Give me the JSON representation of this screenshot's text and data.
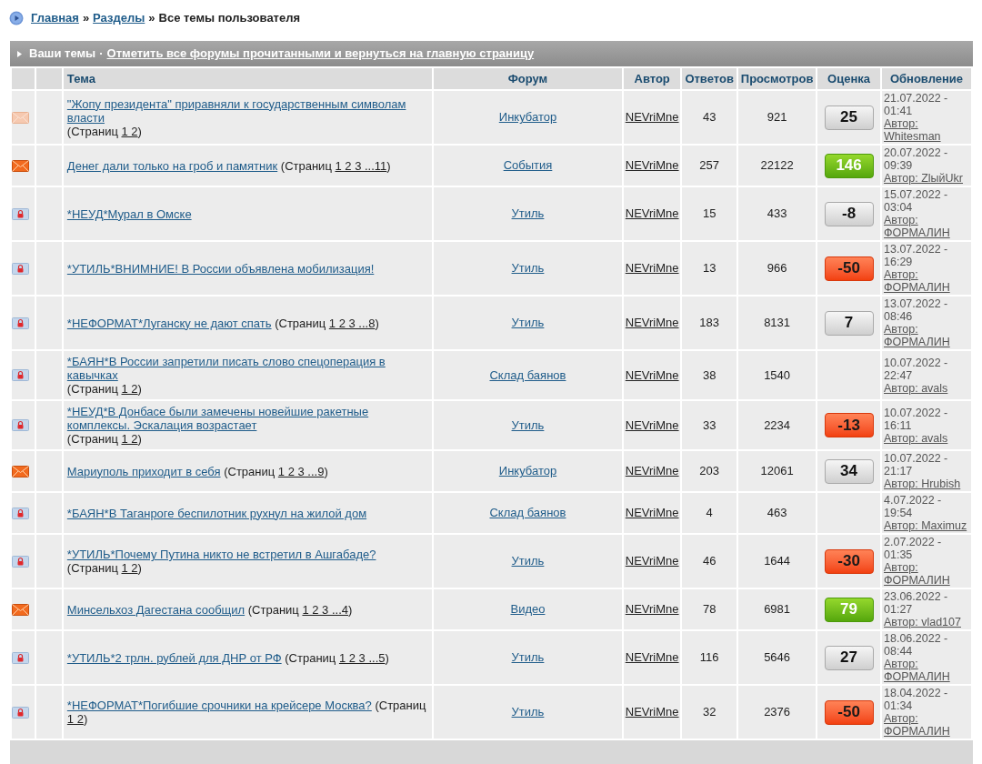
{
  "breadcrumb": {
    "links": [
      "Главная",
      "Разделы"
    ],
    "separators": [
      "»",
      "»"
    ],
    "current": "Все темы пользователя"
  },
  "section": {
    "title": "Ваши темы",
    "separator": "·",
    "link": "Отметить все форумы прочитанными и вернуться на главную страницу"
  },
  "columns": [
    "Тема",
    "Форум",
    "Автор",
    "Ответов",
    "Просмотров",
    "Оценка",
    "Обновление"
  ],
  "rows": [
    {
      "kind": "read",
      "title": "\"Жопу президента\" приравняли к государственным символам власти",
      "pages": {
        "open": "(Страниц",
        "links": "1 2",
        "close": ")"
      },
      "forum": "Инкубатор",
      "author": "NEVriMne",
      "replies": "43",
      "views": "921",
      "rating": {
        "value": "25",
        "kind": "neutral"
      },
      "updated": "21.07.2022 - 01:41",
      "updated_by": "Автор: Whitesman"
    },
    {
      "kind": "hot",
      "title": "Денег дали только на гроб и памятник",
      "pages": {
        "open": "(Страниц",
        "links": "1 2 3 ...11",
        "close": ")"
      },
      "forum": "События",
      "author": "NEVriMne",
      "replies": "257",
      "views": "22122",
      "rating": {
        "value": "146",
        "kind": "positive"
      },
      "updated": "20.07.2022 - 09:39",
      "updated_by": "Автор: ZlыйUkr"
    },
    {
      "kind": "locked",
      "title": "*НЕУД*Мурал в Омске",
      "forum": "Утиль",
      "author": "NEVriMne",
      "replies": "15",
      "views": "433",
      "rating": {
        "value": "-8",
        "kind": "neutral"
      },
      "updated": "15.07.2022 - 03:04",
      "updated_by": "Автор: ФОРМАЛИН"
    },
    {
      "kind": "locked",
      "title": "*УТИЛЬ*ВНИМНИЕ! В России объявлена мобилизация!",
      "forum": "Утиль",
      "author": "NEVriMne",
      "replies": "13",
      "views": "966",
      "rating": {
        "value": "-50",
        "kind": "negative"
      },
      "updated": "13.07.2022 - 16:29",
      "updated_by": "Автор: ФОРМАЛИН"
    },
    {
      "kind": "locked",
      "title": "*НЕФОРМАТ*Луганску не дают спать",
      "pages": {
        "open": "(Страниц",
        "links": "1 2 3 ...8",
        "close": ")"
      },
      "forum": "Утиль",
      "author": "NEVriMne",
      "replies": "183",
      "views": "8131",
      "rating": {
        "value": "7",
        "kind": "neutral"
      },
      "updated": "13.07.2022 - 08:46",
      "updated_by": "Автор: ФОРМАЛИН"
    },
    {
      "kind": "locked",
      "title": "*БАЯН*В России запретили писать слово спецоперация в кавычках",
      "pages": {
        "open": "(Страниц",
        "links": "1 2",
        "close": ")"
      },
      "forum": "Склад баянов",
      "author": "NEVriMne",
      "replies": "38",
      "views": "1540",
      "updated": "10.07.2022 - 22:47",
      "updated_by": "Автор: avals"
    },
    {
      "kind": "locked",
      "title": "*НЕУД*В Донбасе были замечены новейшие ракетные комплексы. Эскалация возрастает",
      "pages": {
        "open": "(Страниц",
        "links": "1 2",
        "close": ")"
      },
      "forum": "Утиль",
      "author": "NEVriMne",
      "replies": "33",
      "views": "2234",
      "rating": {
        "value": "-13",
        "kind": "negative"
      },
      "updated": "10.07.2022 - 16:11",
      "updated_by": "Автор: avals"
    },
    {
      "kind": "hot",
      "title": "Мариуполь приходит в себя",
      "pages": {
        "open": "(Страниц",
        "links": "1 2 3 ...9",
        "close": ")"
      },
      "forum": "Инкубатор",
      "author": "NEVriMne",
      "replies": "203",
      "views": "12061",
      "rating": {
        "value": "34",
        "kind": "neutral"
      },
      "updated": "10.07.2022 - 21:17",
      "updated_by": "Автор: Hrubish"
    },
    {
      "kind": "locked",
      "title": "*БАЯН*В Таганроге беспилотник рухнул на жилой дом",
      "forum": "Склад баянов",
      "author": "NEVriMne",
      "replies": "4",
      "views": "463",
      "updated": "4.07.2022 - 19:54",
      "updated_by": "Автор: Maximuz"
    },
    {
      "kind": "locked",
      "title": "*УТИЛЬ*Почему Путина никто не встретил в Ашгабаде?",
      "pages": {
        "open": "(Страниц",
        "links": "1 2",
        "close": ")"
      },
      "forum": "Утиль",
      "author": "NEVriMne",
      "replies": "46",
      "views": "1644",
      "rating": {
        "value": "-30",
        "kind": "negative"
      },
      "updated": "2.07.2022 - 01:35",
      "updated_by": "Автор: ФОРМАЛИН"
    },
    {
      "kind": "hot",
      "title": "Минсельхоз Дагестана сообщил",
      "pages": {
        "open": "(Страниц",
        "links": "1 2 3 ...4",
        "close": ")"
      },
      "forum": "Видео",
      "author": "NEVriMne",
      "replies": "78",
      "views": "6981",
      "rating": {
        "value": "79",
        "kind": "positive"
      },
      "updated": "23.06.2022 - 01:27",
      "updated_by": "Автор: vlad107"
    },
    {
      "kind": "locked",
      "title": "*УТИЛЬ*2 трлн. рублей для ДНР от РФ",
      "pages": {
        "open": "(Страниц",
        "links": "1 2 3 ...5",
        "close": ")"
      },
      "forum": "Утиль",
      "author": "NEVriMne",
      "replies": "116",
      "views": "5646",
      "rating": {
        "value": "27",
        "kind": "neutral"
      },
      "updated": "18.06.2022 - 08:44",
      "updated_by": "Автор: ФОРМАЛИН"
    },
    {
      "kind": "locked",
      "title": "*НЕФОРМАТ*Погибшие срочники на крейсере Москва?",
      "pages": {
        "open": "(Страниц",
        "links": "1 2",
        "close": ")"
      },
      "forum": "Утиль",
      "author": "NEVriMne",
      "replies": "32",
      "views": "2376",
      "rating": {
        "value": "-50",
        "kind": "negative"
      },
      "updated": "18.04.2022 - 01:34",
      "updated_by": "Автор: ФОРМАЛИН"
    }
  ]
}
